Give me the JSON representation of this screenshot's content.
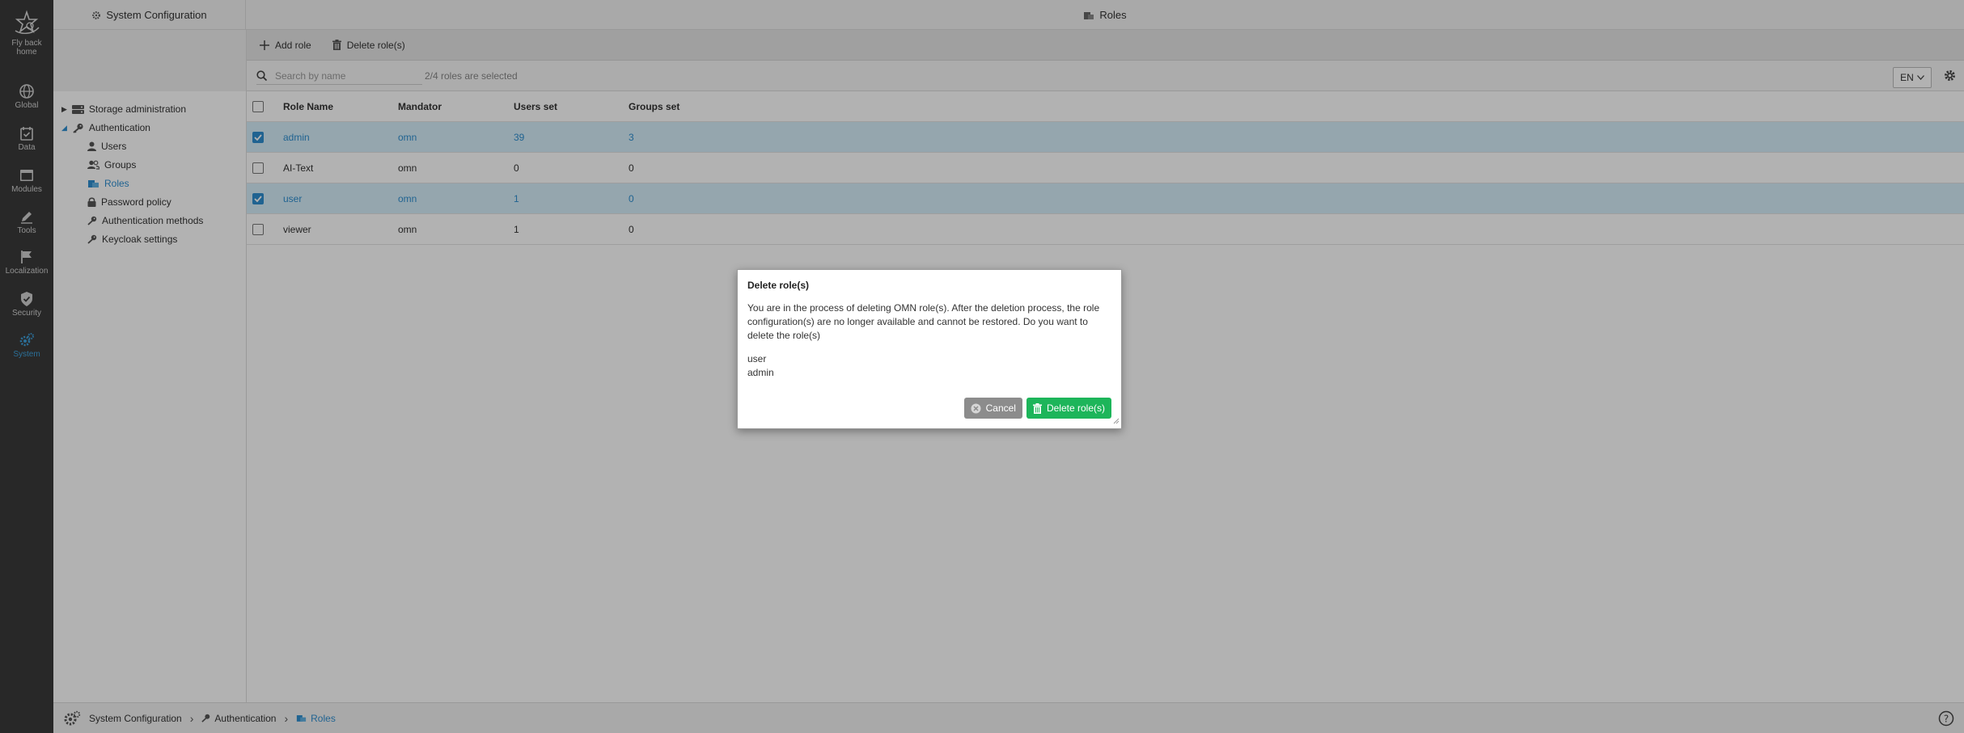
{
  "nav": [
    {
      "label": "Fly back",
      "label2": "home",
      "icon": "star-flyback-icon"
    },
    {
      "label": "Global",
      "icon": "globe-icon"
    },
    {
      "label": "Data",
      "icon": "calendar-check-icon"
    },
    {
      "label": "Modules",
      "icon": "window-icon"
    },
    {
      "label": "Tools",
      "icon": "pencil-icon"
    },
    {
      "label": "Localization",
      "icon": "flag-icon"
    },
    {
      "label": "Security",
      "icon": "shield-check-icon"
    },
    {
      "label": "System",
      "icon": "gears-icon",
      "active": true
    }
  ],
  "topbar": {
    "left_title": "System Configuration",
    "center_title": "Roles"
  },
  "tree": {
    "items": [
      {
        "label": "Storage administration",
        "icon": "storage-icon",
        "expander": "collapsed"
      },
      {
        "label": "Authentication",
        "icon": "key-icon",
        "expander": "expanded"
      },
      {
        "label": "Users",
        "icon": "user-icon"
      },
      {
        "label": "Groups",
        "icon": "users-icon"
      },
      {
        "label": "Roles",
        "icon": "roles-icon",
        "active": true
      },
      {
        "label": "Password policy",
        "icon": "lock-icon"
      },
      {
        "label": "Authentication methods",
        "icon": "key-icon"
      },
      {
        "label": "Keycloak settings",
        "icon": "key-icon"
      }
    ]
  },
  "toolbar": {
    "add_label": "Add role",
    "delete_label": "Delete role(s)"
  },
  "search": {
    "placeholder": "Search by name",
    "value": "",
    "selected_text": "2/4 roles are selected",
    "language": "EN"
  },
  "table": {
    "columns": [
      "Role Name",
      "Mandator",
      "Users set",
      "Groups set"
    ],
    "rows": [
      {
        "name": "admin",
        "mandator": "omn",
        "users": "39",
        "groups": "3",
        "selected": true
      },
      {
        "name": "AI-Text",
        "mandator": "omn",
        "users": "0",
        "groups": "0",
        "selected": false
      },
      {
        "name": "user",
        "mandator": "omn",
        "users": "1",
        "groups": "0",
        "selected": true
      },
      {
        "name": "viewer",
        "mandator": "omn",
        "users": "1",
        "groups": "0",
        "selected": false
      }
    ]
  },
  "breadcrumb": [
    "System Configuration",
    "Authentication",
    "Roles"
  ],
  "dialog": {
    "title": "Delete role(s)",
    "message": "You are in the process of deleting OMN role(s). After the deletion process, the role configuration(s) are no longer available and cannot be restored. Do you want to delete the role(s)",
    "items": [
      "user",
      "admin"
    ],
    "cancel_label": "Cancel",
    "delete_label": "Delete role(s)"
  },
  "colors": {
    "accent": "#2f8fd0",
    "sidebar_bg": "#3a3a3a",
    "selected_row": "#d6eef9",
    "delete_green": "#1db55a",
    "cancel_gray": "#8c8c8c"
  }
}
